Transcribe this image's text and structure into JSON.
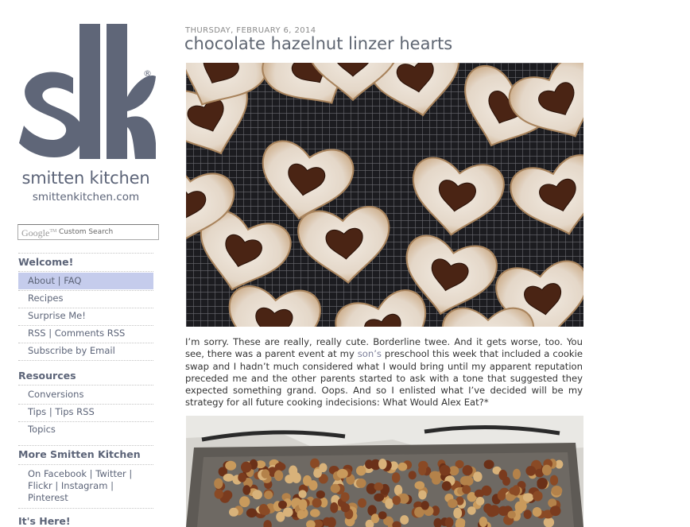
{
  "sidebar": {
    "brand_name": "smitten kitchen",
    "brand_url": "smittenkitchen.com",
    "search": {
      "logo_text": "Google",
      "logo_tm": "TM",
      "placeholder": "Custom Search"
    },
    "welcome": {
      "heading": "Welcome!",
      "items": [
        {
          "label": "About",
          "label2": "FAQ",
          "sep": " | "
        },
        {
          "label": "Recipes"
        },
        {
          "label": "Surprise Me!"
        },
        {
          "label": "RSS",
          "label2": "Comments RSS",
          "sep": " | "
        },
        {
          "label": "Subscribe by Email"
        }
      ]
    },
    "resources": {
      "heading": "Resources",
      "items": [
        {
          "label": "Conversions"
        },
        {
          "label": "Tips",
          "label2": "Tips RSS",
          "sep": " | "
        },
        {
          "label": "Topics"
        }
      ]
    },
    "more": {
      "heading": "More Smitten Kitchen",
      "links": [
        "On Facebook",
        "Twitter",
        "Flickr",
        "Instagram",
        "Pinterest"
      ],
      "sep": " | "
    },
    "next_heading": "It's Here!"
  },
  "post": {
    "date": "THURSDAY, FEBRUARY 6, 2014",
    "title": "chocolate hazelnut linzer hearts",
    "body_before_link": "I’m sorry. These are really, really cute. Borderline twee. And it gets worse, too. You see, there was a parent event at my ",
    "body_link": "son’s",
    "body_after_link": " preschool this week that included a cookie swap and I hadn’t much considered what I would bring until my apparent reputation preceded me and the other parents started to ask with a tone that suggested they expected something grand. Oops. And so I enlisted what I’ve decided will be my strategy for all future cooking indecisions: What Would Alex Eat?*"
  },
  "colors": {
    "brand": "#5c6478",
    "active_bg": "#c5ccec",
    "title": "#5f6672"
  }
}
